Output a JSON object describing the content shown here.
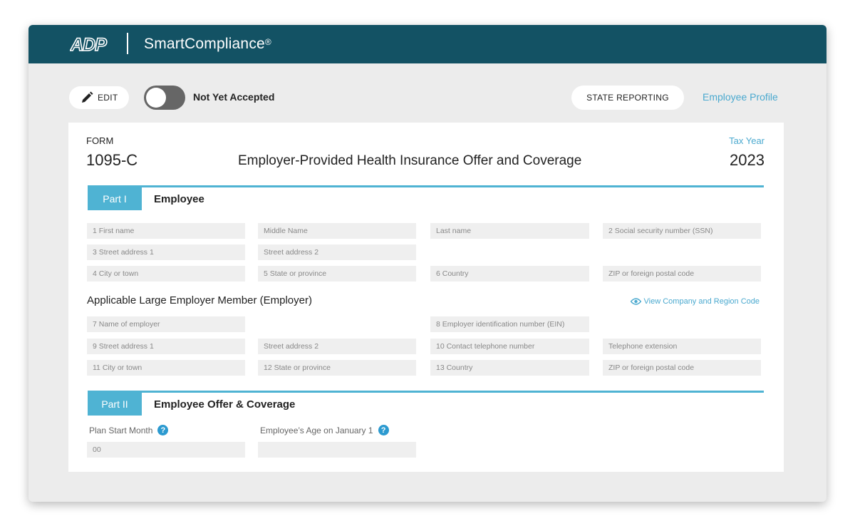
{
  "header": {
    "logo_text": "ADP",
    "app_title": "SmartCompliance",
    "trademark": "®"
  },
  "toolbar": {
    "edit_label": "EDIT",
    "toggle_label": "Not Yet Accepted",
    "toggle_on": false,
    "state_reporting_label": "STATE REPORTING",
    "employee_profile_label": "Employee Profile"
  },
  "form": {
    "form_label": "FORM",
    "form_number": "1095-C",
    "title": "Employer-Provided Health Insurance Offer and Coverage",
    "tax_year_label": "Tax Year",
    "tax_year": "2023"
  },
  "part1": {
    "tag": "Part I",
    "heading": "Employee",
    "fields": {
      "first_name": "1 First name",
      "middle_name": "Middle Name",
      "last_name": "Last name",
      "ssn": "2 Social security number (SSN)",
      "street1": "3 Street address 1",
      "street2": "Street address 2",
      "city": "4 City or town",
      "state": "5 State or province",
      "country": "6 Country",
      "zip": "ZIP or foreign postal code"
    }
  },
  "employer": {
    "heading": "Applicable Large Employer Member (Employer)",
    "view_code_link": "View Company and Region Code",
    "fields": {
      "name": "7 Name of employer",
      "ein": "8 Employer identification number (EIN)",
      "street1": "9 Street address 1",
      "street2": "Street address 2",
      "phone": "10 Contact telephone number",
      "phone_ext": "Telephone extension",
      "city": "11 City or town",
      "state": "12 State or province",
      "country": "13 Country",
      "zip": "ZIP or foreign postal code"
    }
  },
  "part2": {
    "tag": "Part II",
    "heading": "Employee Offer & Coverage",
    "plan_start_label": "Plan Start Month",
    "plan_start_value": "00",
    "age_label": "Employee’s Age on January 1",
    "age_value": "",
    "help_glyph": "?"
  }
}
